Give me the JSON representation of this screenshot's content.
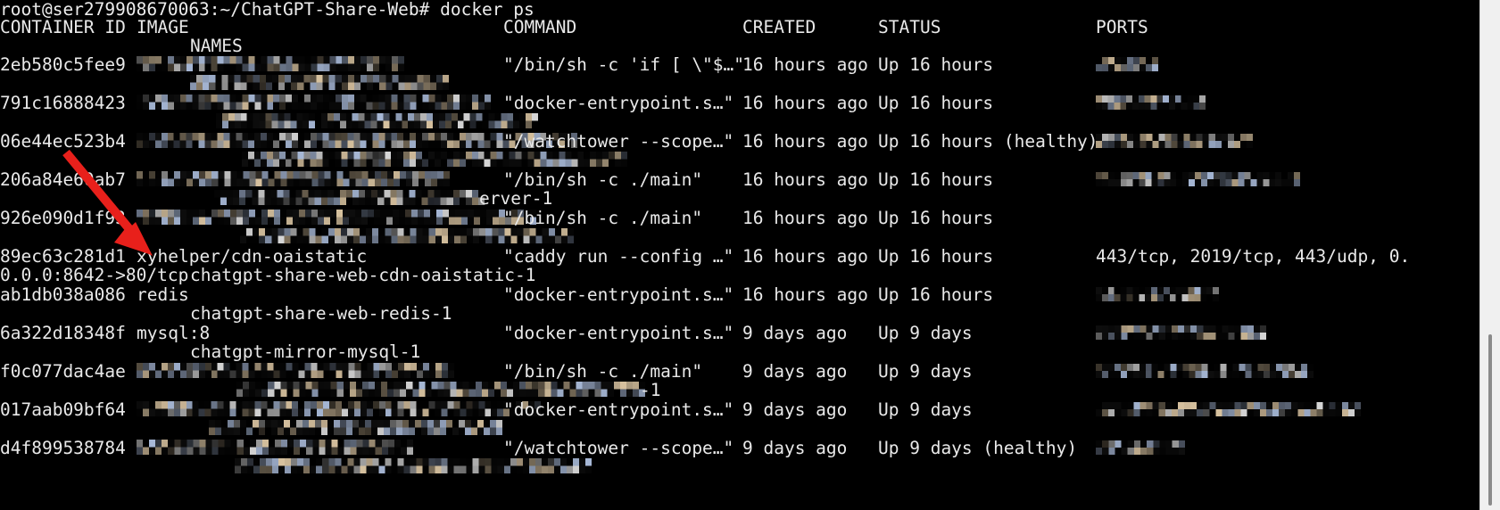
{
  "terminal": {
    "prompt": "root@ser279908670063:~/ChatGPT-Share-Web# ",
    "command": "docker ps",
    "columns": {
      "container_id": "CONTAINER ID",
      "image": "IMAGE",
      "command": "COMMAND",
      "created": "CREATED",
      "status": "STATUS",
      "ports": "PORTS",
      "names": "NAMES"
    },
    "rows": [
      {
        "container_id": "2eb580c5fee9",
        "image": "",
        "image_redacted": true,
        "command": "\"/bin/sh -c 'if [ \\\"$…\"",
        "created": "16 hours ago",
        "status": "Up 16 hours",
        "ports": "",
        "ports_redacted": true,
        "names": "",
        "names_redacted": true
      },
      {
        "container_id": "791c16888423",
        "image": "",
        "image_redacted": true,
        "command": "\"docker-entrypoint.s…\"",
        "created": "16 hours ago",
        "status": "Up 16 hours",
        "ports": "",
        "ports_redacted": true,
        "names": "",
        "names_redacted": true
      },
      {
        "container_id": "06e44ec523b4",
        "image": "",
        "image_redacted": true,
        "command": "\"/watchtower --scope…\"",
        "created": "16 hours ago",
        "status": "Up 16 hours (healthy)",
        "ports": "",
        "ports_redacted": true,
        "names": "",
        "names_redacted": true
      },
      {
        "container_id": "206a84e60ab7",
        "image": "",
        "image_redacted": true,
        "command": "\"/bin/sh -c ./main\"",
        "created": "16 hours ago",
        "status": "Up 16 hours",
        "ports": "",
        "ports_redacted": true,
        "names": "erver-1",
        "names_redacted": true
      },
      {
        "container_id": "926e090d1f93",
        "image": "",
        "image_redacted": true,
        "command": "\"/bin/sh -c ./main\"",
        "created": "16 hours ago",
        "status": "Up 16 hours",
        "ports": "",
        "ports_redacted": false,
        "names": "",
        "names_redacted": true
      },
      {
        "container_id": "89ec63c281d1",
        "image": "xyhelper/cdn-oaistatic",
        "image_redacted": false,
        "command": "\"caddy run --config …\"",
        "created": "16 hours ago",
        "status": "Up 16 hours",
        "ports": "443/tcp, 2019/tcp, 443/udp, 0.",
        "ports_wrap": "0.0.0:8642->80/tcp",
        "ports_redacted": false,
        "names": "chatgpt-share-web-cdn-oaistatic-1",
        "names_redacted": false
      },
      {
        "container_id": "ab1db038a086",
        "image": "redis",
        "image_redacted": false,
        "command": "\"docker-entrypoint.s…\"",
        "created": "16 hours ago",
        "status": "Up 16 hours",
        "ports": "",
        "ports_redacted": true,
        "names": "chatgpt-share-web-redis-1",
        "names_redacted": false
      },
      {
        "container_id": "6a322d18348f",
        "image": "mysql:8",
        "image_redacted": false,
        "command": "\"docker-entrypoint.s…\"",
        "created": "9 days ago",
        "status": "Up 9 days",
        "ports": "",
        "ports_redacted": true,
        "names": "chatgpt-mirror-mysql-1",
        "names_redacted": false
      },
      {
        "container_id": "f0c077dac4ae",
        "image": "",
        "image_redacted": true,
        "command": "\"/bin/sh -c ./main\"",
        "created": "9 days ago",
        "status": "Up 9 days",
        "ports": "",
        "ports_redacted": true,
        "names": "-1",
        "names_redacted": true
      },
      {
        "container_id": "017aab09bf64",
        "image": "",
        "image_redacted": true,
        "command": "\"docker-entrypoint.s…\"",
        "created": "9 days ago",
        "status": "Up 9 days",
        "ports": "",
        "ports_redacted": true,
        "names": "",
        "names_redacted": true
      },
      {
        "container_id": "d4f899538784",
        "image": "",
        "image_redacted": true,
        "command": "\"/watchtower --scope…\"",
        "created": "9 days ago",
        "status": "Up 9 days (healthy)",
        "ports": "",
        "ports_redacted": true,
        "names": "",
        "names_redacted": true
      }
    ]
  },
  "annotation": {
    "arrow_color": "#e8201b",
    "arrow_name": "red-arrow-pointing-to-cdn-oaistatic"
  },
  "scrollbar": {
    "track_color": "#f0f0f0",
    "thumb_color": "#8a8a8a"
  }
}
